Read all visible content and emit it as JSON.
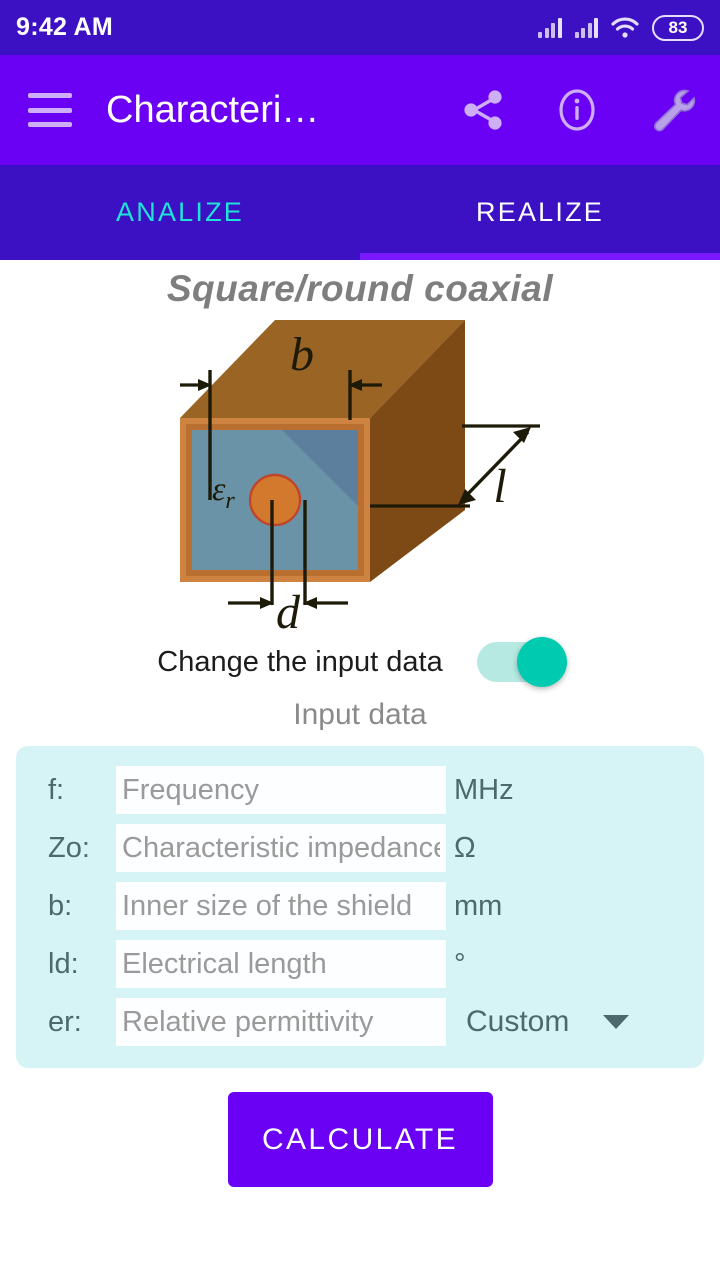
{
  "status_bar": {
    "clock": "9:42 AM",
    "battery_level": "83",
    "icons": [
      "signal-bars-icon",
      "signal-bars-icon",
      "wifi-icon",
      "battery-icon"
    ],
    "background_color": "#3c11c4"
  },
  "app_bar": {
    "title": "Characteri…",
    "menu_icon": "hamburger-menu-icon",
    "actions": [
      {
        "name": "share-icon",
        "label": "share"
      },
      {
        "name": "info-icon",
        "label": "info"
      },
      {
        "name": "wrench-icon",
        "label": "settings"
      }
    ],
    "background_color": "#6a00f4"
  },
  "tabs": {
    "items": [
      {
        "label": "ANALIZE",
        "active": false,
        "color": "#1ee3d7"
      },
      {
        "label": "REALIZE",
        "active": true,
        "color": "#ffffff"
      }
    ],
    "indicator_color": "#7a18ff",
    "background_color": "#3c11c4"
  },
  "figure": {
    "title": "Square/round coaxial",
    "labels": {
      "width": "b",
      "diameter": "d",
      "length": "l",
      "permittivity": "ε",
      "permittivity_sub": "r"
    },
    "colors": {
      "shield_top": "#9a6424",
      "shield_side": "#7d4a16",
      "shield_frame": "#cf8340",
      "dielectric": "#6a93a8",
      "dielectric_shade": "#5c7f9e",
      "conductor": "#d2792e",
      "conductor_outline": "#c0442a",
      "dimension_line": "#1d1a08"
    }
  },
  "toggle": {
    "label": "Change the input data",
    "state": "on",
    "track_color": "#b6e9e2",
    "knob_color": "#00cbb0"
  },
  "input_section": {
    "heading": "Input data",
    "panel_color": "#d6f4f5",
    "fields": [
      {
        "label": "f:",
        "value": "",
        "placeholder": "Frequency",
        "unit": "MHz",
        "unit_type": "text"
      },
      {
        "label": "Zo:",
        "value": "",
        "placeholder": "Characteristic impedance",
        "unit": "Ω",
        "unit_type": "text"
      },
      {
        "label": "b:",
        "value": "",
        "placeholder": "Inner size of the shield",
        "unit": "mm",
        "unit_type": "text"
      },
      {
        "label": "ld:",
        "value": "",
        "placeholder": "Electrical length",
        "unit": "°",
        "unit_type": "text"
      },
      {
        "label": "er:",
        "value": "",
        "placeholder": "Relative permittivity",
        "unit": "",
        "unit_type": "dropdown"
      }
    ],
    "dropdown": {
      "selected": "Custom",
      "options": [
        "Custom"
      ]
    }
  },
  "calculate_button": {
    "label": "CALCULATE",
    "color": "#6a00f4"
  }
}
